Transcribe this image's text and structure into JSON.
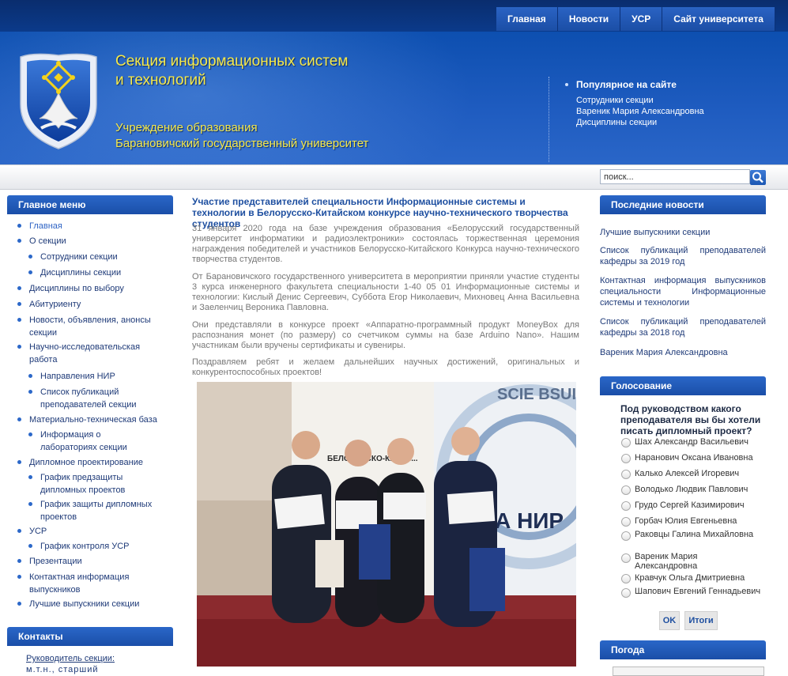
{
  "topnav": [
    {
      "label": "Главная"
    },
    {
      "label": "Новости"
    },
    {
      "label": "УСР"
    },
    {
      "label": "Сайт университета"
    }
  ],
  "header": {
    "title_line1": "Секция информационных систем",
    "title_line2": "и технологий",
    "org_line1": "Учреждение образования",
    "org_line2": "Барановичский государственный университет",
    "popular_heading": "Популярное на сайте",
    "popular_links": [
      "Сотрудники секции",
      "Вареник Мария Александровна",
      "Дисциплины секции"
    ]
  },
  "search": {
    "placeholder": "поиск...",
    "value": "поиск..."
  },
  "left_menu": {
    "heading": "Главное меню",
    "items": [
      {
        "label": "Главная"
      },
      {
        "label": "О секции"
      },
      {
        "label": "Сотрудники секции"
      },
      {
        "label": "Дисциплины секции"
      },
      {
        "label": "Дисциплины по выбору"
      },
      {
        "label": "Абитуриенту"
      },
      {
        "label": "Новости, объявления, анонсы секции"
      },
      {
        "label": "Научно-исследовательская работа"
      },
      {
        "label": "Направления НИР"
      },
      {
        "label": "Список публикаций преподавателей секции"
      },
      {
        "label": "Материально-техническая база"
      },
      {
        "label": "Информация о лабораториях секции"
      },
      {
        "label": "Дипломное проектирование"
      },
      {
        "label": "График предзащиты дипломных проектов"
      },
      {
        "label": "График защиты дипломных проектов"
      },
      {
        "label": "УСР"
      },
      {
        "label": "График контроля УСР"
      },
      {
        "label": "Презентации"
      },
      {
        "label": "Контактная информация выпускников"
      },
      {
        "label": "Лучшие выпускники секции"
      }
    ],
    "contacts_heading": "Контакты",
    "contact_role": "Руководитель секции:",
    "contact_detail": "м.т.н., старший"
  },
  "article": {
    "title": "Участие представителей специальности Информационные системы и технологии в Белорусско-Китайском конкурсе научно-технического творчества студентов",
    "paragraphs": [
      "31 января 2020 года на базе учреждения образования «Белорусский государственный университет информатики и радиоэлектроники» состоялась торжественная церемония награждения победителей и участников Белорусско-Китайского Конкурса научно-технического творчества студентов.",
      "От Барановичского государственного университета в мероприятии приняли участие студенты 3 курса инженерного факультета специальности 1-40 05 01 Информационные системы и технологии: Кислый Денис Сергеевич, Суббота Егор Николаевич, Михновец Анна Васильевна и Заеленчиц Вероника Павловна.",
      "Они представляли в конкурсе проект «Аппаратно-программный продукт MoneyBox для распознания монет (по размеру) со счетчиком суммы на базе Arduino Nano». Нашим участникам были вручены сертификаты и сувениры.",
      "Поздравляем ребят и желаем дальнейших научных достижений, оригинальных и конкурентоспособных проектов!"
    ],
    "photo_banner_right": "SCIE BSUIR",
    "photo_banner_mid": "БЕЛОРУССКО-КИТАЙ...",
    "photo_banner_nip": "КА НИР"
  },
  "right": {
    "news_heading": "Последние новости",
    "news": [
      "Лучшие выпускники секции",
      "Список публикаций преподавателей кафедры за 2019 год",
      "Контактная информация выпускников специальности Информационные системы и технологии",
      "Список публикаций преподавателей кафедры за 2018 год",
      "Вареник Мария Александровна"
    ],
    "vote_heading": "Голосование",
    "vote_question": "Под руководством какого преподавателя вы бы хотели писать дипломный проект?",
    "vote_options": [
      "Шах Александр Васильевич",
      "Наранович Оксана Ивановна",
      "Калько Алексей Игоревич",
      "Володько Людвик Павлович",
      "Грудо Сергей Казимирович",
      "Горбач Юлия Евгеньевна",
      "Раковцы Галина Михайловна",
      "Вареник Мария Александровна",
      "Кравчук Ольга Дмитриевна",
      "Шапович Евгений Геннадьевич"
    ],
    "ok_label": "OK",
    "results_label": "Итоги",
    "weather_heading": "Погода"
  }
}
